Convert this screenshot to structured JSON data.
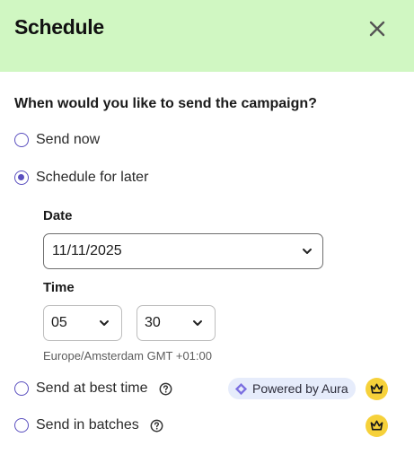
{
  "header": {
    "title": "Schedule",
    "close_icon": "close-icon"
  },
  "question": "When would you like to send the campaign?",
  "options": {
    "send_now": {
      "label": "Send now",
      "checked": false
    },
    "schedule_later": {
      "label": "Schedule for later",
      "checked": true
    },
    "best_time": {
      "label": "Send at best time",
      "checked": false
    },
    "batches": {
      "label": "Send in batches",
      "checked": false
    }
  },
  "date": {
    "label": "Date",
    "value": "11/11/2025"
  },
  "time": {
    "label": "Time",
    "hour": "05",
    "minute": "30"
  },
  "timezone": "Europe/Amsterdam GMT +01:00",
  "aura_badge": {
    "label": "Powered by Aura",
    "icon": "diamond-icon"
  },
  "premium_icon": "crown-icon",
  "colors": {
    "header_bg": "#d0f7c2",
    "radio_accent": "#5a4fbf",
    "crown_bg": "#f6d13a",
    "badge_bg": "#e6ecfb"
  }
}
